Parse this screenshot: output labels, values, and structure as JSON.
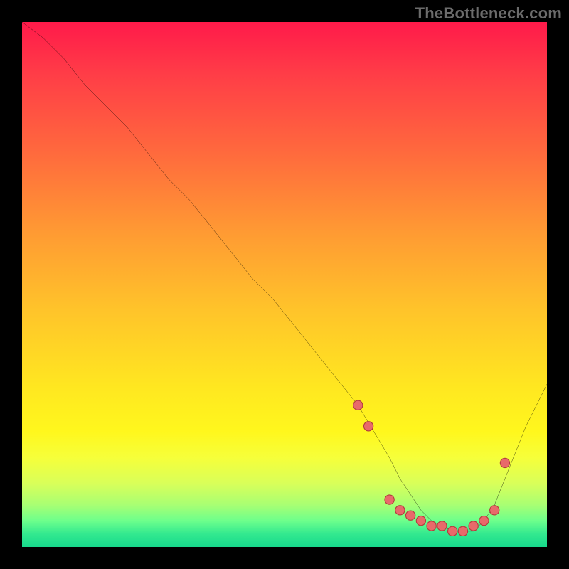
{
  "watermark": {
    "text": "TheBottleneck.com"
  },
  "colors": {
    "frame": "#000000",
    "gradient_top": "#ff1a4a",
    "gradient_mid": "#ffe820",
    "gradient_bottom": "#17d98c",
    "curve": "#000000",
    "points_fill": "#e86a6a",
    "points_stroke": "#b13d3d"
  },
  "chart_data": {
    "type": "line",
    "title": "",
    "xlabel": "",
    "ylabel": "",
    "xlim": [
      0,
      100
    ],
    "ylim": [
      0,
      100
    ],
    "grid": false,
    "legend": false,
    "series": [
      {
        "name": "curve",
        "x": [
          0,
          4,
          8,
          12,
          16,
          20,
          24,
          28,
          32,
          36,
          40,
          44,
          48,
          52,
          56,
          60,
          64,
          67,
          70,
          72,
          74,
          76,
          78,
          80,
          82,
          84,
          86,
          88,
          90,
          92,
          94,
          96,
          98,
          100
        ],
        "y": [
          100,
          97,
          93,
          88,
          84,
          80,
          75,
          70,
          66,
          61,
          56,
          51,
          47,
          42,
          37,
          32,
          27,
          22,
          17,
          13,
          10,
          7,
          5,
          4,
          3,
          3,
          3,
          5,
          8,
          13,
          18,
          23,
          27,
          31
        ]
      }
    ],
    "points": {
      "name": "highlighted-points",
      "x": [
        64,
        66,
        70,
        72,
        74,
        76,
        78,
        80,
        82,
        84,
        86,
        88,
        90,
        92
      ],
      "y": [
        27,
        23,
        9,
        7,
        6,
        5,
        4,
        4,
        3,
        3,
        4,
        5,
        7,
        16
      ]
    }
  }
}
